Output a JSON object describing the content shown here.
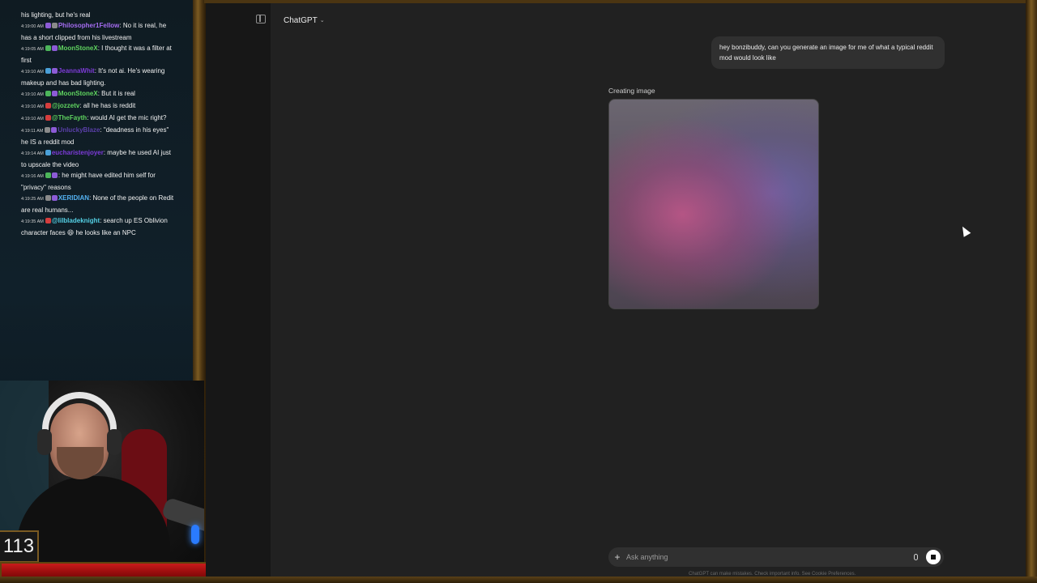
{
  "chat": {
    "messages": [
      {
        "time": "",
        "badges": [],
        "user": "",
        "user_color": "",
        "text": "his lighting, but he's real"
      },
      {
        "time": "4:19:00 AM",
        "badges": [
          "purple",
          "gray"
        ],
        "user": "Philosopher1Fellow",
        "user_color": "u-purple",
        "text": ": No it is real, he has a short clipped from his livestream"
      },
      {
        "time": "4:19:05 AM",
        "badges": [
          "green",
          "purple"
        ],
        "user": "MoonStoneX",
        "user_color": "u-green",
        "text": ": I thought it was a filter at first"
      },
      {
        "time": "4:19:10 AM",
        "badges": [
          "blue",
          "purple"
        ],
        "user": "JeannaWhit",
        "user_color": "u-violet",
        "text": ": It's not ai. He's wearing makeup and has bad lighting."
      },
      {
        "time": "4:19:10 AM",
        "badges": [
          "green",
          "purple"
        ],
        "user": "MoonStoneX",
        "user_color": "u-green",
        "text": ": But it is real"
      },
      {
        "time": "4:19:10 AM",
        "badges": [
          "red"
        ],
        "user": "@jozzetv",
        "user_color": "u-green",
        "text": ": all he has is reddit"
      },
      {
        "time": "4:19:10 AM",
        "badges": [
          "red"
        ],
        "user": "@TheFayth",
        "user_color": "u-green",
        "text": ": would AI get the mic right?"
      },
      {
        "time": "4:19:11 AM",
        "badges": [
          "gray",
          "purple"
        ],
        "user": "UnluckyBlaze",
        "user_color": "u-dark",
        "text": ": \"deadness in his eyes\" he IS a reddit mod"
      },
      {
        "time": "4:19:14 AM",
        "badges": [
          "blue"
        ],
        "user": "eucharistenjoyer",
        "user_color": "u-violet",
        "text": ": maybe he used AI just to upscale the video"
      },
      {
        "time": "4:19:16 AM",
        "badges": [
          "green",
          "purple"
        ],
        "user": "",
        "user_color": "u-dark",
        "text": ": he might have edited him self for \"privacy\" reasons"
      },
      {
        "time": "4:19:25 AM",
        "badges": [
          "gray",
          "purple"
        ],
        "user": "XERIDIAN",
        "user_color": "u-blue",
        "text": ": None of the people on Redit are real humans..."
      },
      {
        "time": "4:19:35 AM",
        "badges": [
          "red"
        ],
        "user": "@lilbladeknight",
        "user_color": "u-cyan",
        "text": ": search up ES Oblivion character faces 😄 he looks like an NPC"
      }
    ]
  },
  "stream": {
    "counter": "113"
  },
  "app": {
    "model_name": "ChatGPT",
    "user_message": "hey bonzibuddy, can you generate an image for me of what a typical reddit mod would look like",
    "creating_label": "Creating image",
    "composer_placeholder": "Ask anything",
    "footnote": "ChatGPT can make mistakes. Check important info. See Cookie Preferences."
  },
  "icons": {
    "sidebar_toggle": "sidebar-toggle-icon",
    "chevron": "chevron-down-icon",
    "plus": "plus-icon",
    "mic": "microphone-icon",
    "stop": "stop-icon"
  },
  "colors": {
    "app_bg": "#212121",
    "bubble_bg": "#303030",
    "frame_gold": "#7a5a22",
    "health_red": "#c91b1b"
  }
}
